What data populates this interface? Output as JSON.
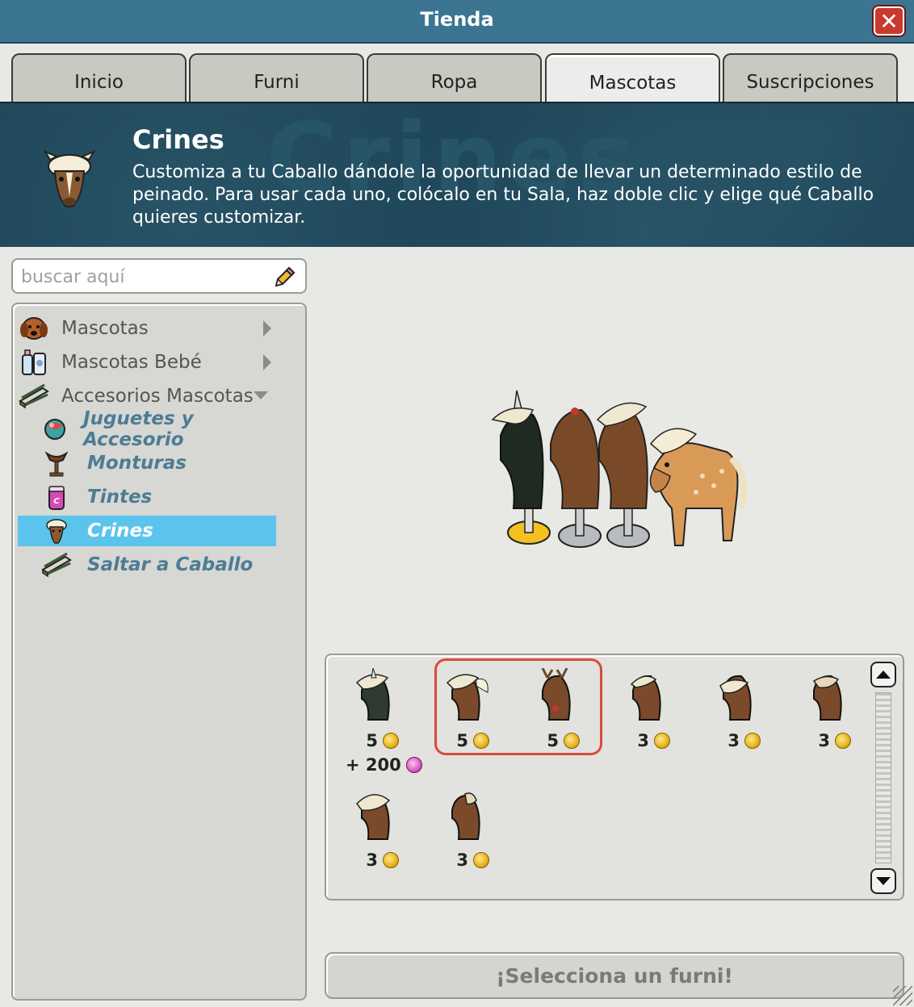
{
  "window": {
    "title": "Tienda"
  },
  "tabs": [
    {
      "label": "Inicio"
    },
    {
      "label": "Furni"
    },
    {
      "label": "Ropa"
    },
    {
      "label": "Mascotas"
    },
    {
      "label": "Suscripciones"
    }
  ],
  "active_tab": "Mascotas",
  "banner": {
    "title": "Crines",
    "watermark": "Crines",
    "description": "Customiza a tu Caballo dándole la oportunidad de llevar un determinado estilo de peinado. Para usar cada uno, colócalo en tu Sala, haz doble clic y elige qué Caballo quieres customizar."
  },
  "search": {
    "placeholder": "buscar aquí"
  },
  "categories": [
    {
      "label": "Mascotas",
      "icon": "dog-icon"
    },
    {
      "label": "Mascotas Bebé",
      "icon": "baby-bottle-icon"
    },
    {
      "label": "Accesorios Mascotas",
      "icon": "fence-icon"
    }
  ],
  "subcategories": [
    {
      "label": "Juguetes y Accesorio",
      "icon": "ball-icon"
    },
    {
      "label": "Monturas",
      "icon": "saddle-icon"
    },
    {
      "label": "Tintes",
      "icon": "dye-icon"
    },
    {
      "label": "Crines",
      "icon": "horse-head-icon"
    },
    {
      "label": "Saltar a Caballo",
      "icon": "jump-fence-icon"
    }
  ],
  "selected_subcategory": "Crines",
  "items": [
    {
      "price": "5",
      "extra": "+ 200",
      "color": "#2f3a30"
    },
    {
      "price": "5",
      "color": "#7a4a2a"
    },
    {
      "price": "5",
      "color": "#7a4a2a"
    },
    {
      "price": "3",
      "color": "#7a4a2a"
    },
    {
      "price": "3",
      "color": "#7a4a2a"
    },
    {
      "price": "3",
      "color": "#7a4a2a"
    },
    {
      "price": "3",
      "color": "#7a4a2a"
    },
    {
      "price": "3",
      "color": "#7a4a2a"
    }
  ],
  "select_button": "¡Selecciona un furni!",
  "colors": {
    "titlebar": "#3c7592",
    "banner": "#1d4557",
    "selected": "#5bc4ec",
    "highlight": "#d94b3a"
  }
}
